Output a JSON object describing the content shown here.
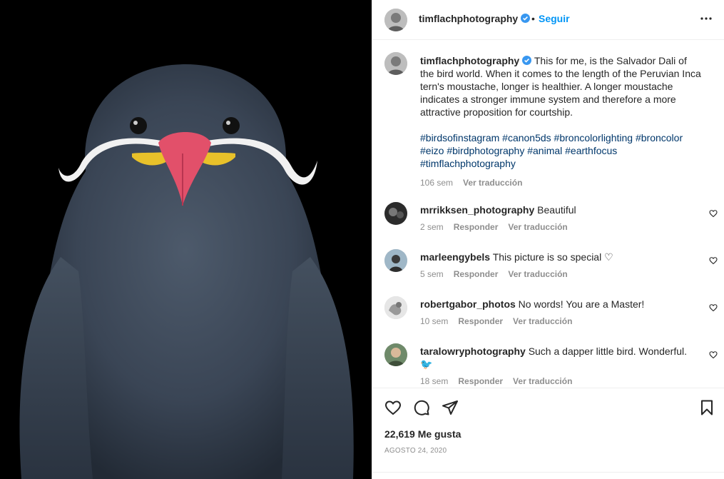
{
  "post": {
    "username": "timflachphotography",
    "follow_label": "Seguir",
    "separator": "•",
    "caption": "This for me, is the Salvador Dali of the bird world. When it comes to the length of the Peruvian Inca tern's moustache, longer is healthier. A longer moustache indicates a stronger immune system and therefore a more attractive proposition for courtship.",
    "hashtags": "#birdsofinstagram #canon5ds #broncolorlighting #broncolor #eizo #birdphotography #animal #earthfocus #timflachphotography",
    "caption_time": "106 sem",
    "translate_label": "Ver traducción",
    "likes": "22,619 Me gusta",
    "date": "AGOSTO 24, 2020"
  },
  "comments": [
    {
      "username": "mrrikksen_photography",
      "text": "Beautiful",
      "time": "2 sem",
      "reply": "Responder",
      "translate": "Ver traducción"
    },
    {
      "username": "marleengybels",
      "text": "This picture is so special ♡",
      "time": "5 sem",
      "reply": "Responder",
      "translate": "Ver traducción"
    },
    {
      "username": "robertgabor_photos",
      "text": "No words! You are a Master!",
      "time": "10 sem",
      "reply": "Responder",
      "translate": "Ver traducción"
    },
    {
      "username": "taralowryphotography",
      "text": "Such a dapper little bird. Wonderful. 🐦",
      "time": "18 sem",
      "reply": "Responder",
      "translate": "Ver traducción"
    }
  ],
  "icons": {
    "verified": "verified-badge-icon",
    "more": "more-options-icon",
    "like": "heart-icon",
    "comment": "comment-icon",
    "share": "share-icon",
    "save": "bookmark-icon"
  },
  "colors": {
    "accent": "#0095f6",
    "hashtag": "#00376b",
    "muted": "#8e8e8e",
    "text": "#262626"
  }
}
